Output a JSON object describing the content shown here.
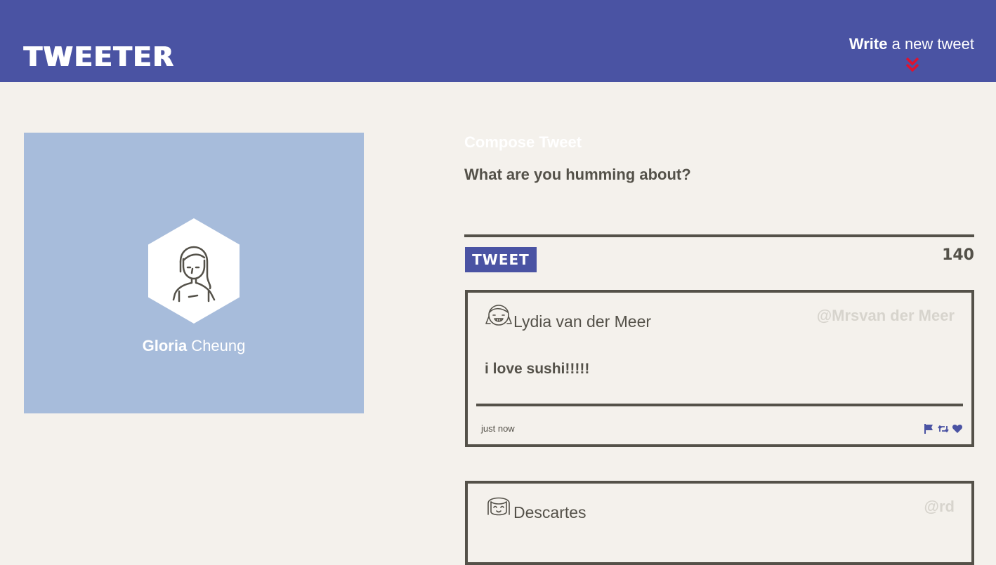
{
  "nav": {
    "brand": "TWEETER",
    "write_strong": "Write",
    "write_rest": " a new tweet",
    "write_icon": "double-chevron-down-icon"
  },
  "profile": {
    "first_name": "Gloria",
    "last_name": " Cheung",
    "background_color": "#a7bcdb"
  },
  "composer": {
    "title": "Compose Tweet",
    "placeholder": "What are you humming about?",
    "button_label": "TWEET",
    "counter": "140"
  },
  "tweets": [
    {
      "name": "Lydia van der Meer",
      "handle": "@Mrsvan der Meer",
      "body": "i love sushi!!!!!",
      "time": "just now",
      "actions": [
        "flag-icon",
        "retweet-icon",
        "heart-icon"
      ]
    },
    {
      "name": "Descartes",
      "handle": "@rd"
    }
  ],
  "colors": {
    "primary": "#4a53a3",
    "background": "#f4f1ec",
    "text": "#545149",
    "accent": "#e0122e",
    "handle": "#d7d4cd"
  }
}
